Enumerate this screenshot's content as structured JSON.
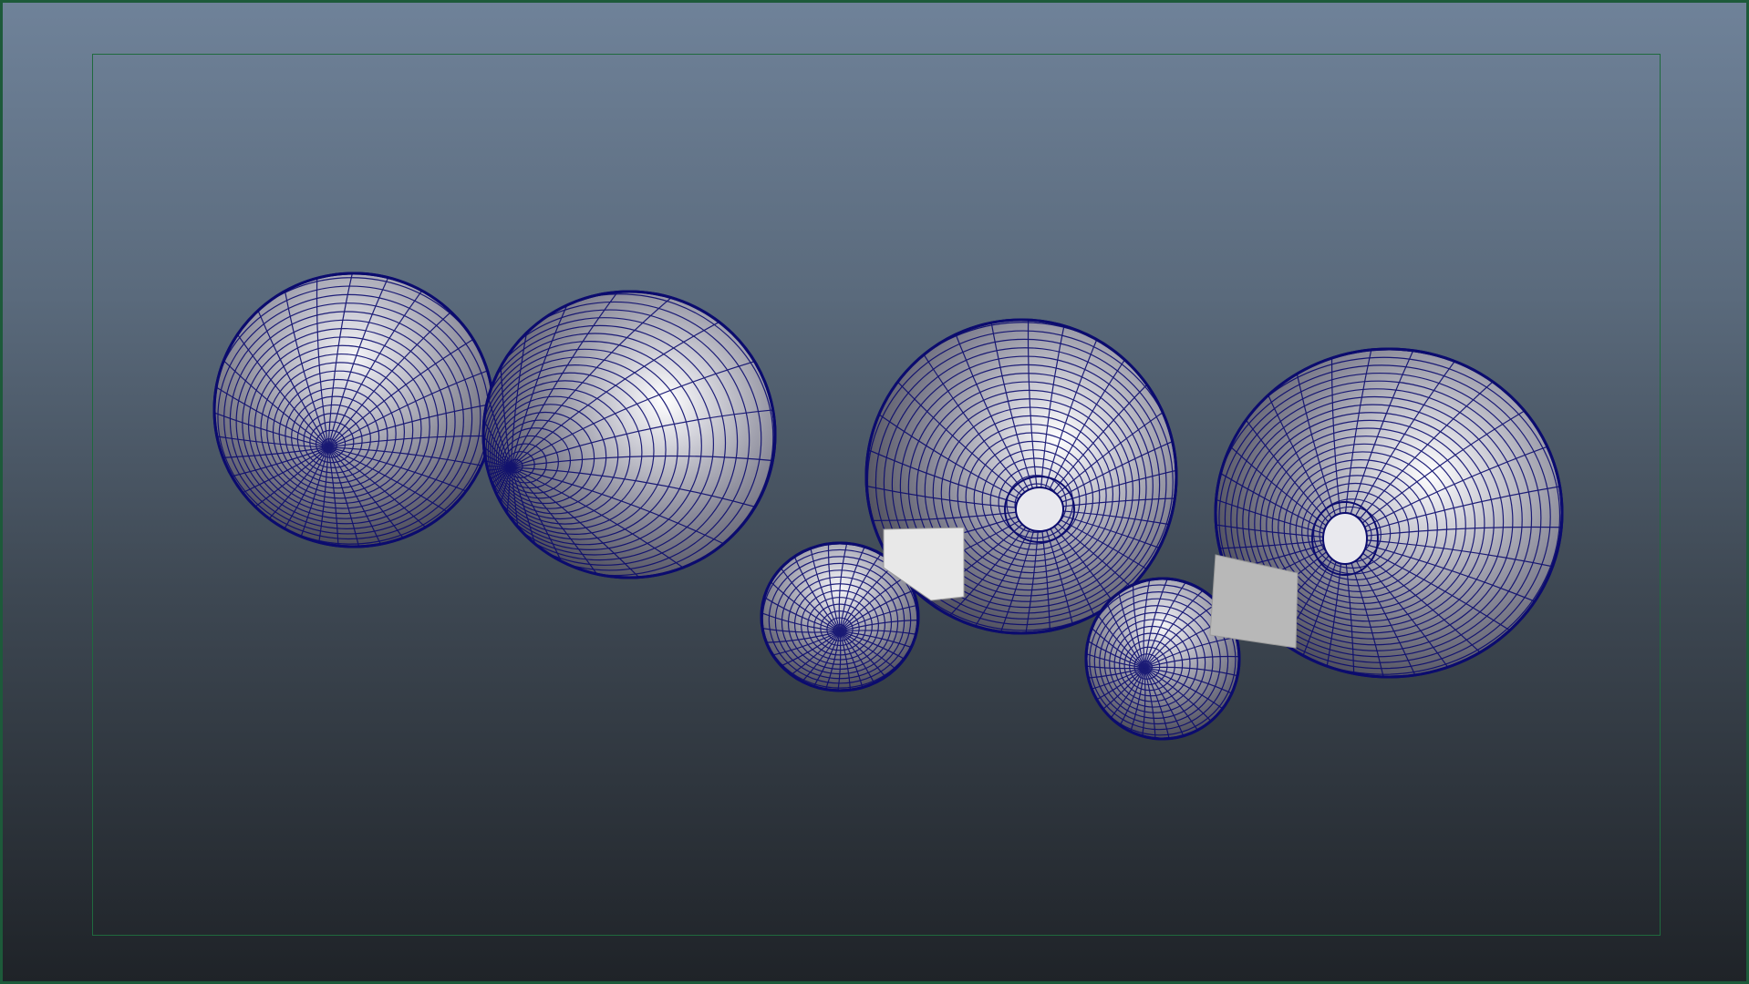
{
  "viewport": {
    "background_top": "#6f8299",
    "background_bottom": "#1f2328",
    "border_color": "#1d5a3a",
    "resolution_gate_color": "#1f6a3e"
  },
  "scene": {
    "wireframe_color": "#0b0b6e",
    "surface_light": "#ffffff",
    "surface_dark": "#3a3a46",
    "objects": [
      {
        "name": "sphere-1",
        "kind": "sphere"
      },
      {
        "name": "sphere-2",
        "kind": "sphere"
      },
      {
        "name": "torus-sphere-1",
        "kind": "torus"
      },
      {
        "name": "small-sphere-1",
        "kind": "sphere"
      },
      {
        "name": "plane-1",
        "kind": "plane"
      },
      {
        "name": "torus-sphere-2",
        "kind": "torus"
      },
      {
        "name": "small-sphere-2",
        "kind": "sphere"
      },
      {
        "name": "plane-2",
        "kind": "plane"
      }
    ]
  }
}
